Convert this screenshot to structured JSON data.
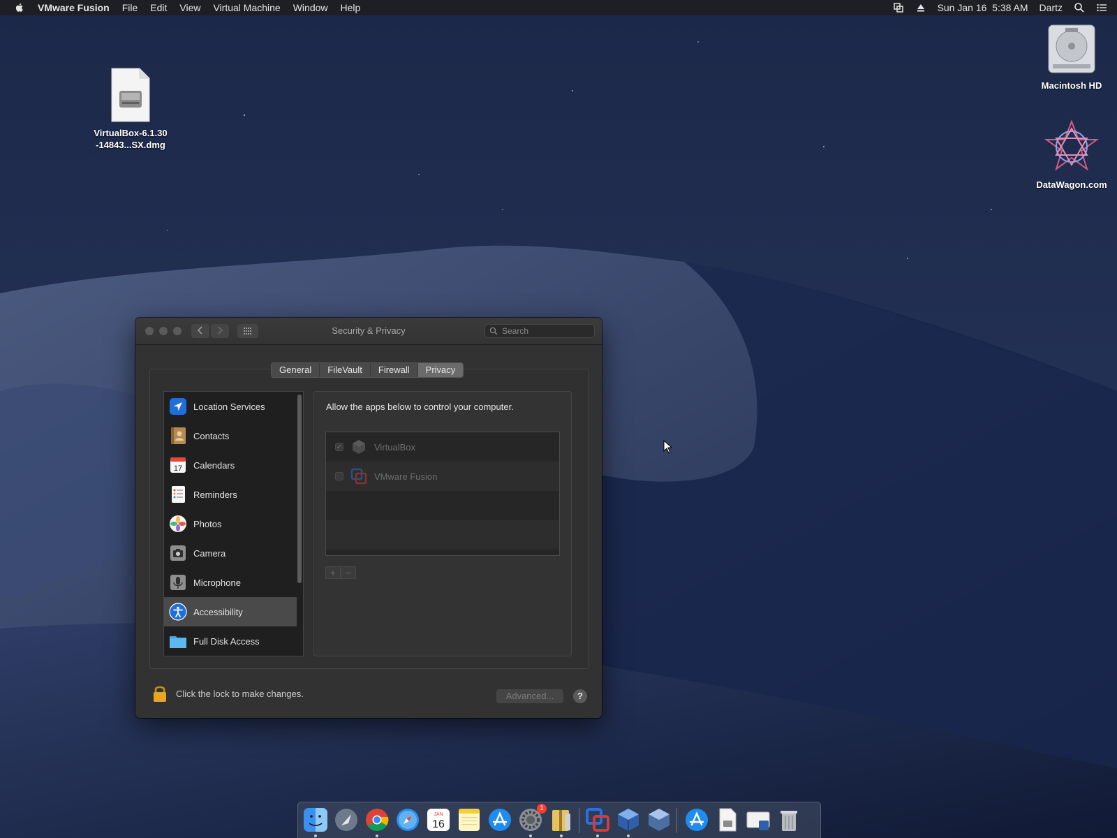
{
  "menubar": {
    "app_name": "VMware Fusion",
    "items": [
      "File",
      "Edit",
      "View",
      "Virtual Machine",
      "Window",
      "Help"
    ],
    "datetime": "Sun Jan 16  5:38 AM",
    "user": "Dartz"
  },
  "desktop": {
    "icons": [
      {
        "name": "virtualbox-dmg",
        "label_line1": "VirtualBox-6.1.30",
        "label_line2": "-14843...SX.dmg"
      },
      {
        "name": "macintosh-hd",
        "label": "Macintosh HD"
      },
      {
        "name": "datawagon",
        "label": "DataWagon.com"
      }
    ]
  },
  "window": {
    "title": "Security & Privacy",
    "search_placeholder": "Search",
    "tabs": [
      {
        "label": "General",
        "active": false
      },
      {
        "label": "FileVault",
        "active": false
      },
      {
        "label": "Firewall",
        "active": false
      },
      {
        "label": "Privacy",
        "active": true
      }
    ],
    "categories": [
      {
        "label": "Location Services",
        "icon": "location-icon"
      },
      {
        "label": "Contacts",
        "icon": "contacts-icon"
      },
      {
        "label": "Calendars",
        "icon": "calendar-icon",
        "badge_text": "17"
      },
      {
        "label": "Reminders",
        "icon": "reminders-icon"
      },
      {
        "label": "Photos",
        "icon": "photos-icon"
      },
      {
        "label": "Camera",
        "icon": "camera-icon"
      },
      {
        "label": "Microphone",
        "icon": "microphone-icon"
      },
      {
        "label": "Accessibility",
        "icon": "accessibility-icon",
        "selected": true
      },
      {
        "label": "Full Disk Access",
        "icon": "folder-icon"
      }
    ],
    "pane": {
      "description": "Allow the apps below to control your computer.",
      "apps": [
        {
          "name": "VirtualBox",
          "checked": true
        },
        {
          "name": "VMware Fusion",
          "checked": false
        }
      ],
      "add_label": "+",
      "remove_label": "−"
    },
    "lock_text": "Click the lock to make changes.",
    "advanced_label": "Advanced...",
    "help_label": "?"
  },
  "dock": {
    "calendar_day": "16",
    "calendar_month": "JAN",
    "settings_badge": "1"
  },
  "colors": {
    "wallpaper_dark": "#0f1830",
    "window_bg": "#323232",
    "accent_blue": "#1e6fd9",
    "lock_gold": "#e5a527"
  }
}
